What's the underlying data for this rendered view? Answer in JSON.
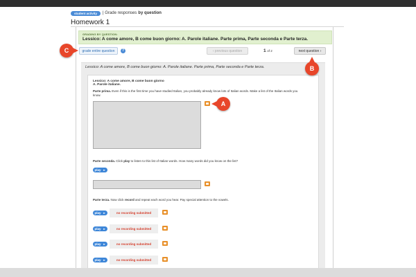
{
  "breadcrumb": {
    "pill": "student activity",
    "text": "| Grade responses",
    "bold": "by question"
  },
  "page_title": "Homework 1",
  "banner": {
    "label": "GRADING BY QUESTION:",
    "question": "Lessico: A come amore, B come buon giorno: A. Parole italiane. Parte prima, Parte seconda e Parte terza."
  },
  "toolbar": {
    "grade_entire": "grade entire question",
    "help": "?",
    "previous": "‹ previous question",
    "next": "next question ›",
    "current_page": "1",
    "of_pages": "of 2"
  },
  "markers": {
    "a": "A",
    "b": "B",
    "c": "C"
  },
  "question": {
    "heading": "Lessico: A come amore, B come buon giorno: A. Parole italiane. Parte prima, Parte seconda e Parte terza.",
    "title": "Lessico: A come amore, B come buon giorno",
    "subtitle": "A. Parole italiane.",
    "p1_label": "Parte prima.",
    "p1_text": " Even if this is the first time you have studied Italian, you probably already know lots of Italian words. Make a list of the Italian words you know.",
    "p2_label": "Parte seconda.",
    "p2_text_a": " Click ",
    "p2_bold": "play",
    "p2_text_b": " to listen to this list of Italian words. How many words did you know on the list?",
    "p3_label": "Parte terza.",
    "p3_text_a": " Now click ",
    "p3_bold": "record",
    "p3_text_b": " and repeat each word you hear. Pay special attention to the vowels.",
    "play_label": "play",
    "play_arrow": "►",
    "no_recording": "no recording submitted"
  }
}
